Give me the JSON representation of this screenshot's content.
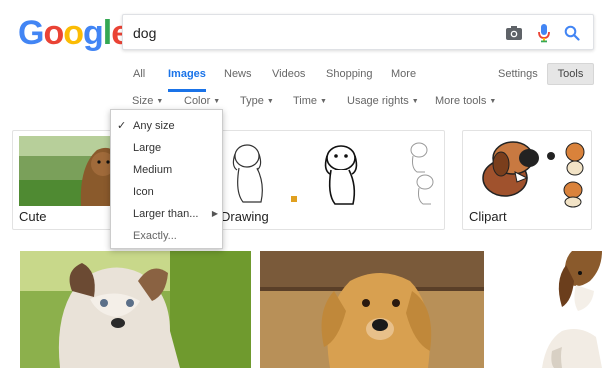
{
  "logo": {
    "letters": [
      "G",
      "o",
      "o",
      "g",
      "l",
      "e"
    ],
    "colors": [
      "#4285F4",
      "#EA4335",
      "#FBBC05",
      "#4285F4",
      "#34A853",
      "#EA4335"
    ]
  },
  "search": {
    "query": "dog",
    "icons": [
      "camera-icon",
      "mic-icon",
      "search-icon"
    ]
  },
  "tabs": {
    "all": "All",
    "images": "Images",
    "news": "News",
    "videos": "Videos",
    "shopping": "Shopping",
    "more": "More",
    "settings": "Settings",
    "tools": "Tools"
  },
  "filters": {
    "size": "Size",
    "color": "Color",
    "type": "Type",
    "time": "Time",
    "usage": "Usage rights",
    "more_tools": "More tools"
  },
  "size_menu": {
    "any_size": "Any size",
    "large": "Large",
    "medium": "Medium",
    "icon": "Icon",
    "larger_than": "Larger than...",
    "exactly": "Exactly...",
    "selected": "Any size"
  },
  "related": {
    "cute": "Cute",
    "drawing": "Drawing",
    "clipart": "Clipart"
  },
  "accent": "#1a73e8"
}
